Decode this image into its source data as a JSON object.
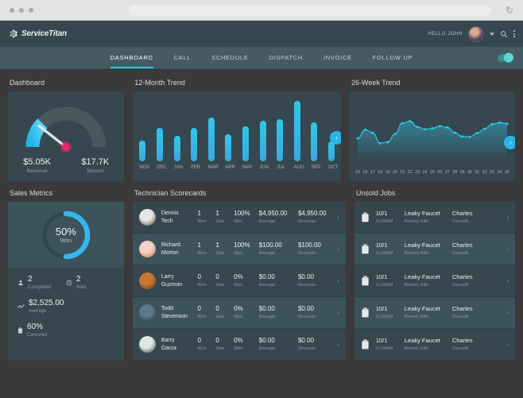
{
  "browser": {
    "reload_icon": "reload-icon",
    "url_value": "",
    "url_placeholder": ""
  },
  "header": {
    "logo_text": "ServiceTitan",
    "greeting": "HELLO JOHN",
    "search_icon": "search-icon",
    "menu_icon": "kebab-menu-icon",
    "avatar_alt": "user-avatar"
  },
  "nav": {
    "tabs": [
      {
        "label": "DASHBOARD",
        "active": true
      },
      {
        "label": "CALL",
        "active": false
      },
      {
        "label": "SCHEDULE",
        "active": false
      },
      {
        "label": "DISPATCH",
        "active": false
      },
      {
        "label": "INVOICE",
        "active": false
      },
      {
        "label": "FOLLOW UP",
        "active": false
      }
    ],
    "toggle_on": true
  },
  "panels": {
    "dashboard_title": "Dashboard",
    "twelve_month_title": "12-Month Trend",
    "twenty_six_week_title": "26-Week Trend",
    "sales_metrics_title": "Sales Metrics",
    "technician_title": "Technician Scorecards",
    "unsold_title": "Unsold Jobs"
  },
  "gauge": {
    "revenue_value": "$5.05K",
    "revenue_label": "Revenue",
    "missed_value": "$17.7K",
    "missed_label": "Missed",
    "needle_angle_deg": -52,
    "fill_pct": 22,
    "accent_color": "#2ec8ea",
    "track_color": "#47585f",
    "needle_hub_color": "#e8226b"
  },
  "sales_metrics": {
    "donut_pct": "50%",
    "donut_label": "Won",
    "donut_value": 50,
    "accent_color": "#32b8ec",
    "items": [
      {
        "icon": "person-icon",
        "value": "2",
        "label": "Completed"
      },
      {
        "icon": "clock-icon",
        "value": "2",
        "label": "Sold"
      },
      {
        "icon": "trend-line-icon",
        "value": "$2,525.00",
        "label": "Average"
      },
      {
        "icon": "trash-icon",
        "value": "60%",
        "label": "Canceled"
      }
    ]
  },
  "technicians": {
    "column_labels": {
      "won": "Won",
      "sale": "Sale",
      "pct": "Won",
      "avg": "Average",
      "rev": "Revenue"
    },
    "chevron_icon": "chevron-right-icon",
    "rows": [
      {
        "name_first": "Dennis",
        "name_last": "Tech",
        "won": "1",
        "sale": "1",
        "pct": "100%",
        "avg": "$4,950.00",
        "rev": "$4,950.00",
        "av1": "#e8e5e0",
        "av2": "#3c3732"
      },
      {
        "name_first": "Richard",
        "name_last": "Morton",
        "won": "1",
        "sale": "1",
        "pct": "100%",
        "avg": "$100.00",
        "rev": "$100.00",
        "av1": "#f3cfc6",
        "av2": "#c06a3e"
      },
      {
        "name_first": "Larry",
        "name_last": "Guzman",
        "won": "0",
        "sale": "0",
        "pct": "0%",
        "avg": "$0.00",
        "rev": "$0.00",
        "av1": "#c8762e",
        "av2": "#6a3c18"
      },
      {
        "name_first": "Todd",
        "name_last": "Stevenson",
        "won": "0",
        "sale": "0",
        "pct": "0%",
        "avg": "$0.00",
        "rev": "$0.00",
        "av1": "#5d7a8c",
        "av2": "#2c3c47"
      },
      {
        "name_first": "Barry",
        "name_last": "Garza",
        "won": "0",
        "sale": "0",
        "pct": "0%",
        "avg": "$0.00",
        "rev": "$0.00",
        "av1": "#dfe7e0",
        "av2": "#2e3a3c"
      }
    ]
  },
  "unsold_jobs": {
    "icon": "trash-job-icon",
    "chevron_icon": "chevron-right-icon",
    "rows": [
      {
        "date": "10/1",
        "time": "11:50AM",
        "title": "Leaky Faucet",
        "location": "Beverly Hills",
        "person": "Charles",
        "status": "Canceld"
      },
      {
        "date": "10/1",
        "time": "11:50AM",
        "title": "Leaky Faucet",
        "location": "Beverly Hills",
        "person": "Charles",
        "status": "Canceld"
      },
      {
        "date": "10/1",
        "time": "11:50AM",
        "title": "Leaky Faucet",
        "location": "Beverly Hills",
        "person": "Charles",
        "status": "Canceld"
      },
      {
        "date": "10/1",
        "time": "11:50AM",
        "title": "Leaky Faucet",
        "location": "Beverly Hills",
        "person": "Charles",
        "status": "Canceld"
      },
      {
        "date": "10/1",
        "time": "11:50AM",
        "title": "Leaky Faucet",
        "location": "Beverly Hills",
        "person": "Charles",
        "status": "Canceld"
      }
    ]
  },
  "chart_data": [
    {
      "type": "bar",
      "title": "12-Month Trend",
      "categories": [
        "NOV",
        "DEC",
        "JAN",
        "FEB",
        "MAR",
        "APR",
        "MAY",
        "JUN",
        "JUL",
        "AUG",
        "SEP",
        "OCT"
      ],
      "values": [
        30,
        47,
        36,
        48,
        62,
        38,
        50,
        58,
        60,
        86,
        55,
        28
      ],
      "xlabel": "",
      "ylabel": "",
      "ylim": [
        0,
        100
      ],
      "grid": false,
      "legend": false,
      "series_color": "#2ec8ea",
      "next_button": "next-arrow-button"
    },
    {
      "type": "area",
      "title": "26-Week Trend",
      "x": [
        15,
        16,
        17,
        18,
        19,
        20,
        21,
        22,
        23,
        24,
        25,
        26,
        27,
        28,
        29,
        30,
        31,
        32,
        33,
        34,
        35
      ],
      "values": [
        38,
        56,
        50,
        28,
        30,
        47,
        70,
        74,
        62,
        57,
        59,
        64,
        61,
        50,
        42,
        41,
        49,
        58,
        68,
        71,
        69
      ],
      "xlabel": "",
      "ylabel": "",
      "ylim": [
        0,
        100
      ],
      "grid": false,
      "legend": false,
      "line_color": "#2ec8ea",
      "marker": "circle",
      "next_button": "next-arrow-button"
    },
    {
      "type": "pie",
      "title": "Sales Metrics Won",
      "categories": [
        "Won",
        "Remaining"
      ],
      "values": [
        50,
        50
      ],
      "donut": true,
      "center_label": "50%",
      "center_sublabel": "Won",
      "colors": [
        "#32b8ec",
        "#2f4852"
      ]
    },
    {
      "type": "gauge",
      "title": "Dashboard Revenue Gauge",
      "categories": [
        "Revenue",
        "Missed"
      ],
      "values": [
        5050,
        17700
      ],
      "value_labels": [
        "$5.05K",
        "$17.7K"
      ],
      "fill_pct": 22,
      "colors": [
        "#2ec8ea",
        "#47585f"
      ]
    }
  ]
}
